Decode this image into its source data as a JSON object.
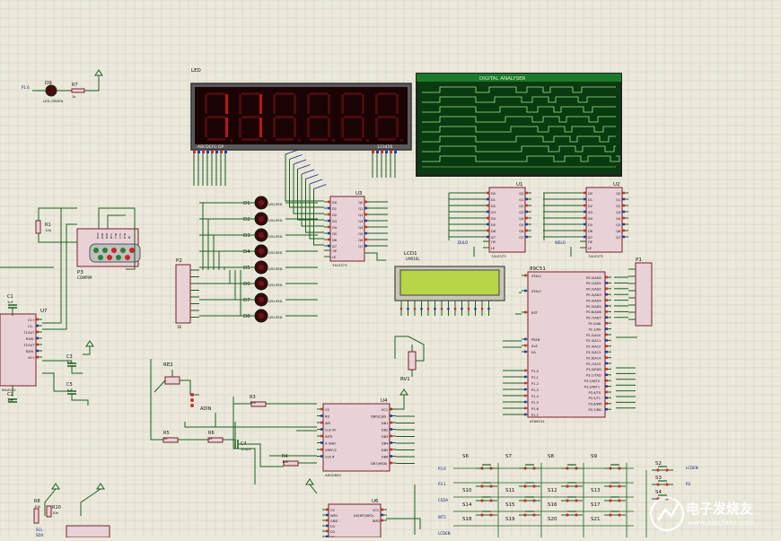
{
  "colors": {
    "background": "#ebe9db",
    "grid": "#d2cfbd",
    "wire": "#1b5e20",
    "body_fill": "#e8d2d6",
    "body_stroke": "#7a1f2b",
    "label": "#111111",
    "net": "#1a237e",
    "pin_red": "#d32f2f",
    "pin_blue": "#1e3fa8",
    "led_digit_on": "#c0141a",
    "led_digit_off": "#4a0c0e",
    "lcd_green": "#b8d448",
    "scope_bg": "#0a3a10",
    "scope_trace": "#9ee88f"
  },
  "display": {
    "ref": "LED",
    "segment_caption": "ABCDEFG DP",
    "digit_caption": "123456",
    "digits_shown": "11"
  },
  "scope": {
    "title": "DIGITAL ANALYSER",
    "channels": 8
  },
  "chips": {
    "u1": {
      "ref": "U1",
      "pins_left": [
        "D0",
        "D1",
        "D2",
        "D3",
        "D4",
        "D5",
        "D6",
        "D7"
      ],
      "pins_right": [
        "Q0",
        "Q1",
        "Q2",
        "Q3",
        "Q4",
        "Q5",
        "Q6",
        "Q7"
      ],
      "bottom_pins": [
        "OE",
        "LE"
      ],
      "part": "74LS373"
    },
    "u2": {
      "ref": "U2",
      "pins_left": [
        "D0",
        "D1",
        "D2",
        "D3",
        "D4",
        "D5",
        "D6",
        "D7"
      ],
      "pins_right": [
        "Q0",
        "Q1",
        "Q2",
        "Q3",
        "Q4",
        "Q5",
        "Q6",
        "Q7"
      ],
      "bottom_pins": [
        "OE",
        "LE"
      ],
      "part": "74LS373"
    },
    "u3": {
      "ref": "U3",
      "pins_left": [
        "D0",
        "D1",
        "D2",
        "D3",
        "D4",
        "D5",
        "D6",
        "D7"
      ],
      "pins_right": [
        "Q0",
        "Q1",
        "Q2",
        "Q3",
        "Q4",
        "Q5",
        "Q6",
        "Q7"
      ],
      "bottom_pins": [
        "OE",
        "LE"
      ],
      "part": "74LS373"
    },
    "mcu": {
      "ref": "89C51",
      "left_pins": [
        "XTAL1",
        "XTAL2",
        "RST",
        "PSEN",
        "ALE",
        "EA",
        "P1.0",
        "P1.1",
        "P1.2",
        "P1.3",
        "P1.4",
        "P1.5",
        "P1.6",
        "P1.7"
      ],
      "right_pins": [
        "P0.0/AD0",
        "P0.1/AD1",
        "P0.2/AD2",
        "P0.3/AD3",
        "P0.4/AD4",
        "P0.5/AD5",
        "P0.6/AD6",
        "P0.7/AD7",
        "P2.0/A8",
        "P2.1/A9",
        "P2.2/A10",
        "P2.3/A11",
        "P2.4/A12",
        "P2.5/A13",
        "P2.6/A14",
        "P2.7/A15",
        "P3.0/RXD",
        "P3.1/TXD",
        "P3.2/INT0",
        "P3.3/INT1",
        "P3.4/T0",
        "P3.5/T1",
        "P3.6/WR",
        "P3.7/RD"
      ],
      "part": "AT89C51"
    },
    "u4": {
      "ref": "U4",
      "left_pins": [
        "CS",
        "RD",
        "WR",
        "CLK IN",
        "INTR",
        "A GND",
        "VREF/2",
        "CLK R"
      ],
      "right_pins": [
        "VCC",
        "DB0(LSB)",
        "DB1",
        "DB2",
        "DB3",
        "DB4",
        "DB5",
        "DB6",
        "DB7(MSB)"
      ],
      "part": "ADC0804"
    },
    "u6": {
      "ref": "U6",
      "left_pins": [
        "CS",
        "WR1",
        "GND",
        "D3",
        "D2",
        "D1"
      ],
      "right_pins": [
        "VCC",
        "ILE(BY1/BY2)",
        "WR2"
      ],
      "part": "DAC0832"
    },
    "u7": {
      "ref": "U7",
      "left_pins": [
        "C1+",
        "C1-",
        "T1OUT",
        "R1IN",
        "T2OUT",
        "R2IN",
        "VS+"
      ],
      "right_pins": [
        "C2+",
        "C2-",
        "VS-"
      ],
      "part": "MAX232"
    }
  },
  "lcd": {
    "ref": "LCD1",
    "part": "LM016L"
  },
  "connectors": {
    "p1": {
      "ref": "P1"
    },
    "p2": {
      "ref": "P2",
      "part": "1K"
    },
    "p3": {
      "ref": "P3",
      "part": "COMPIM",
      "pins": [
        "DCD",
        "DSR",
        "RXD",
        "RTS",
        "TXD",
        "CTS",
        "DTR",
        "RI"
      ]
    }
  },
  "leds": {
    "d9": {
      "ref": "D9",
      "part": "LED-GREEN"
    },
    "bar": [
      "D1",
      "D2",
      "D3",
      "D4",
      "D5",
      "D6",
      "D7",
      "D8"
    ],
    "bar_part": "LED-RED"
  },
  "resistors": {
    "r1": {
      "ref": "R1",
      "value": "10k"
    },
    "r3": {
      "ref": "R3",
      "value": "10k"
    },
    "r4": {
      "ref": "R4",
      "value": "10k"
    },
    "r5": {
      "ref": "R5",
      "value": "1k"
    },
    "r6": {
      "ref": "R6",
      "value": "1k"
    },
    "r7": {
      "ref": "R7",
      "value": "1k"
    },
    "r8": {
      "ref": "R8",
      "value": "10k"
    },
    "r10": {
      "ref": "R10",
      "value": "10k"
    },
    "re2": {
      "ref": "RE2"
    },
    "rv1": {
      "ref": "RV1"
    }
  },
  "caps": {
    "c1": {
      "ref": "C1",
      "value": "1uF"
    },
    "c2": {
      "ref": "C2",
      "value": "1uF"
    },
    "c3": {
      "ref": "C3",
      "value": "1uF"
    },
    "c4": {
      "ref": "C4",
      "value": "100pF"
    },
    "c5": {
      "ref": "C5",
      "value": "1uF"
    }
  },
  "labels": {
    "adin": "ADIN",
    "p16": "P1.6",
    "dulo": "DULO",
    "welo": "WELO",
    "p36": "P3.6",
    "p31": "P3.1",
    "csda": "CSDA",
    "int1": "INT1",
    "lcden": "LCDEN",
    "rs": "RS",
    "scl": "SCL",
    "sda": "SDA"
  },
  "switches": {
    "grid_cols": [
      "S6",
      "S7",
      "S8",
      "S9"
    ],
    "rows": [
      [
        "S10",
        "S11",
        "S12",
        "S13"
      ],
      [
        "S14",
        "S15",
        "S16",
        "S17"
      ],
      [
        "S18",
        "S19",
        "S20",
        "S21"
      ]
    ],
    "extra": [
      "S2",
      "S3",
      "S4"
    ]
  },
  "watermark": {
    "cn": "电子发烧友",
    "url": "www.elecfans.com"
  }
}
